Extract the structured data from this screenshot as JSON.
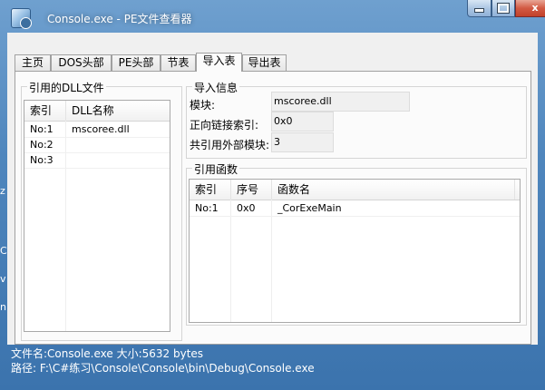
{
  "window": {
    "title": "Console.exe - PE文件查看器",
    "min_label": "",
    "max_label": "",
    "close_label": "x"
  },
  "tabs": [
    {
      "label": "主页"
    },
    {
      "label": "DOS头部"
    },
    {
      "label": "PE头部"
    },
    {
      "label": "节表"
    },
    {
      "label": "导入表",
      "active": true
    },
    {
      "label": "导出表"
    }
  ],
  "dll_group": {
    "caption": "引用的DLL文件",
    "columns": [
      "索引",
      "DLL名称"
    ],
    "rows": [
      [
        "No:1",
        "mscoree.dll"
      ],
      [
        "No:2",
        ""
      ],
      [
        "No:3",
        ""
      ]
    ]
  },
  "import_info": {
    "caption": "导入信息",
    "module_label": "模块:",
    "module_value": "mscoree.dll",
    "forward_label": "正向链接索引:",
    "forward_value": "0x0",
    "count_label": "共引用外部模块:",
    "count_value": "3"
  },
  "functions_group": {
    "caption": "引用函数",
    "columns": [
      "索引",
      "序号",
      "函数名"
    ],
    "rows": [
      [
        "No:1",
        "0x0",
        "_CorExeMain"
      ]
    ]
  },
  "status": {
    "line1": "文件名:Console.exe   大小:5632 bytes",
    "line2": "路径: F:\\C#练习\\Console\\Console\\bin\\Debug\\Console.exe"
  },
  "background_fragments": [
    "z",
    "C",
    "v",
    "n"
  ],
  "colors": {
    "desktop": "#4f86bd",
    "client": "#f0f0f0",
    "close_button": "#c2412a"
  }
}
